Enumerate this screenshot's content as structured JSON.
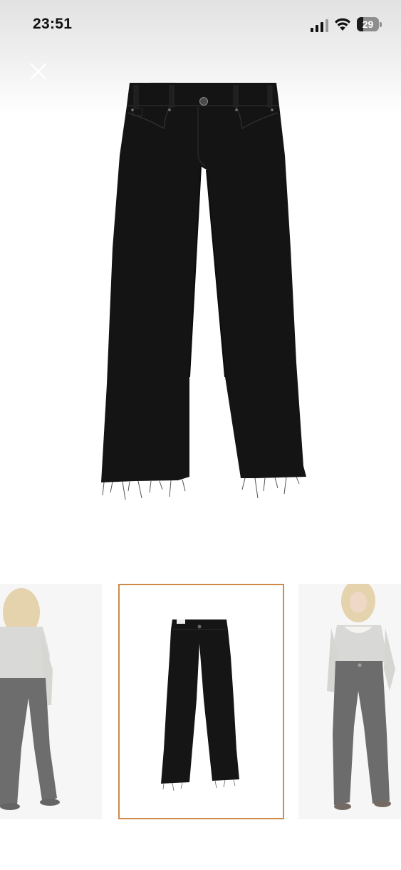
{
  "status_bar": {
    "time": "23:51",
    "battery_level": "29",
    "battery_fraction": 0.29
  },
  "viewer": {
    "close_icon": "close-icon",
    "main_image": "black-wide-leg-jeans-product-photo",
    "selected_thumbnail_index": 1,
    "thumbnails": [
      {
        "name": "thumbnail-model-back-view",
        "selected": false
      },
      {
        "name": "thumbnail-jeans-flat",
        "selected": true
      },
      {
        "name": "thumbnail-model-front-view",
        "selected": false
      }
    ]
  },
  "colors": {
    "selection_border": "#d08a4a",
    "jeans": "#141414",
    "top_background": "#e2e2e2"
  }
}
